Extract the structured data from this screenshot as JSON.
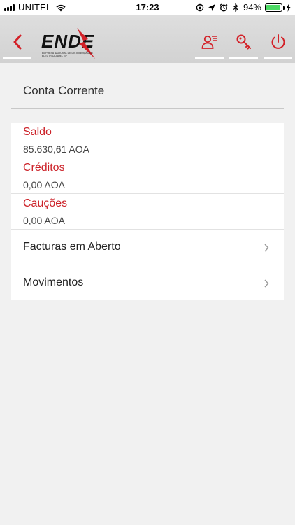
{
  "status_bar": {
    "carrier": "UNITEL",
    "time": "17:23",
    "battery_percent": "94%",
    "battery_level": 0.94,
    "signal_bars": 4,
    "icons": [
      "signal-icon",
      "wifi-icon",
      "orientation-lock-icon",
      "location-icon",
      "alarm-icon",
      "bluetooth-icon",
      "battery-icon",
      "charging-bolt-icon"
    ],
    "battery_color": "#4cd964"
  },
  "header": {
    "logo_text": "ENDE",
    "logo_subtitle": "EMPRESA NACIONAL DE DISTRIBUIÇÃO DE ELECTRICIDADE - EP",
    "accent_color": "#d32128",
    "icons": [
      "back-arrow-icon",
      "user-list-icon",
      "key-icon",
      "power-icon"
    ]
  },
  "section": {
    "title": "Conta Corrente"
  },
  "balances": [
    {
      "label": "Saldo",
      "value": "85.630,61 AOA"
    },
    {
      "label": "Créditos",
      "value": "0,00 AOA"
    },
    {
      "label": "Cauções",
      "value": "0,00 AOA"
    }
  ],
  "links": [
    {
      "label": "Facturas em Aberto",
      "icon": "chevron-right-icon"
    },
    {
      "label": "Movimentos",
      "icon": "chevron-right-icon"
    }
  ],
  "colors": {
    "label_red": "#cc2229",
    "background": "#f1f1f1",
    "header_gray": "#d6d6d6"
  }
}
